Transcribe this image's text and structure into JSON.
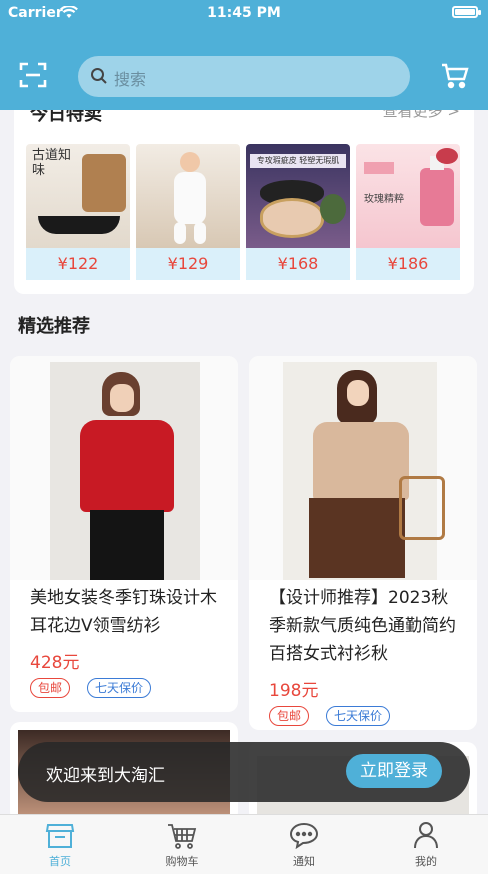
{
  "status_bar": {
    "carrier": "Carrier",
    "time": "11:45 PM"
  },
  "header": {
    "search_placeholder": "搜索"
  },
  "today_deals": {
    "title": "今日特卖",
    "more": "查看更多 >",
    "items": [
      {
        "price": "¥122",
        "image_text": "古道知味"
      },
      {
        "price": "¥129"
      },
      {
        "price": "¥168",
        "image_text": "专攻瑕疵皮 轻塑无瑕肌"
      },
      {
        "price": "¥186",
        "image_text": "玫瑰精粹"
      }
    ]
  },
  "featured": {
    "title": "精选推荐",
    "products": [
      {
        "name": "美地女装冬季钉珠设计木耳花边V领雪纺衫",
        "price": "428元",
        "tags": [
          "包邮",
          "七天保价"
        ]
      },
      {
        "name": "【设计师推荐】2023秋季新款气质纯色通勤简约百搭女式衬衫秋",
        "price": "198元",
        "tags": [
          "包邮",
          "七天保价"
        ]
      }
    ]
  },
  "login_banner": {
    "text": "欢迎来到大淘汇",
    "button": "立即登录"
  },
  "tabbar": {
    "items": [
      {
        "label": "首页",
        "icon": "home-shop-icon",
        "active": true
      },
      {
        "label": "购物车",
        "icon": "shopping-cart-icon",
        "active": false
      },
      {
        "label": "通知",
        "icon": "chat-bubble-icon",
        "active": false
      },
      {
        "label": "我的",
        "icon": "person-icon",
        "active": false
      }
    ]
  },
  "colors": {
    "accent": "#4fb0d8",
    "price": "#e8473c",
    "tag_blue": "#3b7bd6"
  }
}
